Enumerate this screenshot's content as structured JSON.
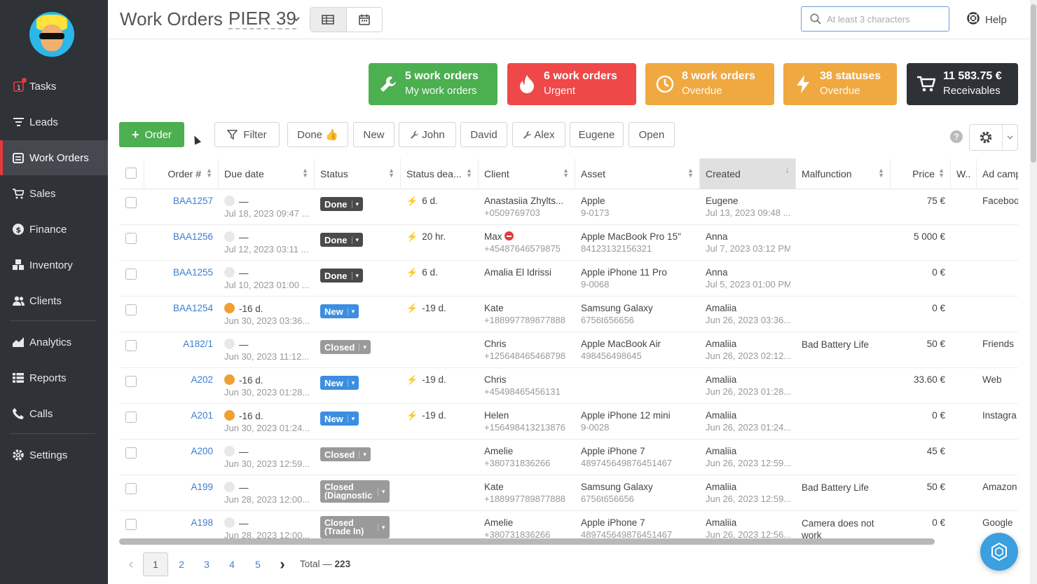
{
  "sidebar": {
    "items": [
      {
        "label": "Tasks",
        "icon": "tasks-icon"
      },
      {
        "label": "Leads",
        "icon": "filter-icon"
      },
      {
        "label": "Work Orders",
        "icon": "work-orders-icon"
      },
      {
        "label": "Sales",
        "icon": "cart-icon"
      },
      {
        "label": "Finance",
        "icon": "dollar-icon"
      },
      {
        "label": "Inventory",
        "icon": "boxes-icon"
      },
      {
        "label": "Clients",
        "icon": "users-icon"
      },
      {
        "label": "Analytics",
        "icon": "chart-icon"
      },
      {
        "label": "Reports",
        "icon": "list-icon"
      },
      {
        "label": "Calls",
        "icon": "phone-icon"
      },
      {
        "label": "Settings",
        "icon": "gear-icon"
      }
    ]
  },
  "header": {
    "title": "Work Orders",
    "location": "PIER 39",
    "search_placeholder": "At least 3 characters",
    "help_label": "Help"
  },
  "cards": [
    {
      "line1": "5 work orders",
      "line2": "My work orders",
      "color": "#4caf50",
      "icon": "wrench-icon"
    },
    {
      "line1": "6 work orders",
      "line2": "Urgent",
      "color": "#ef4848",
      "icon": "flame-icon"
    },
    {
      "line1": "8 work orders",
      "line2": "Overdue",
      "color": "#f0a840",
      "icon": "clock-icon"
    },
    {
      "line1": "38 statuses",
      "line2": "Overdue",
      "color": "#f0a840",
      "icon": "bolt-icon"
    },
    {
      "line1": "11 583.75 €",
      "line2": "Receivables",
      "color": "#2e3237",
      "icon": "cart-icon"
    }
  ],
  "filters": {
    "order_label": "Order",
    "filter_label": "Filter",
    "chips": [
      "Done 👍",
      "New",
      "John",
      "David",
      "Alex",
      "Eugene",
      "Open"
    ]
  },
  "columns": [
    "Order #",
    "Due date",
    "Status",
    "Status dea...",
    "Client",
    "Asset",
    "Created",
    "Malfunction",
    "Price",
    "W..",
    "Ad camp"
  ],
  "rows": [
    {
      "order": "BAA1257",
      "due": "—",
      "due_date": "Jul 18, 2023 09:47 ...",
      "due_clock": "grey",
      "status": "Done",
      "status_type": "done",
      "deadline": "6 d.",
      "deadline_bolt": "grey",
      "client": "Anastasiia Zhylts...",
      "phone": "+0509769703",
      "asset": "Apple",
      "asset_sub": "9-0173",
      "created_by": "Eugene",
      "created_at": "Jul 13, 2023 09:48 ...",
      "malfunction": "",
      "price": "75 €",
      "ad": "Faceboo"
    },
    {
      "order": "BAA1256",
      "due": "—",
      "due_date": "Jul 12, 2023 03:11 ...",
      "due_clock": "grey",
      "status": "Done",
      "status_type": "done",
      "deadline": "20 hr.",
      "deadline_bolt": "grey",
      "client": "Max",
      "phone": "+45487646579875",
      "asset": "Apple MacBook Pro 15\"",
      "asset_sub": "84123132156321",
      "created_by": "Anna",
      "created_at": "Jul 7, 2023 03:12 PM",
      "malfunction": "",
      "price": "5 000 €",
      "ad": ""
    },
    {
      "order": "BAA1255",
      "due": "—",
      "due_date": "Jul 10, 2023 01:00 ...",
      "due_clock": "grey",
      "status": "Done",
      "status_type": "done",
      "deadline": "6 d.",
      "deadline_bolt": "grey",
      "client": "Amalia El Idrissi",
      "phone": "",
      "asset": "Apple iPhone 11 Pro",
      "asset_sub": "9-0068",
      "created_by": "Anna",
      "created_at": "Jul 5, 2023 01:00 PM",
      "malfunction": "",
      "price": "0 €",
      "ad": ""
    },
    {
      "order": "BAA1254",
      "due": "-16 d.",
      "due_date": "Jun 30, 2023 03:36...",
      "due_clock": "orange",
      "status": "New",
      "status_type": "new",
      "deadline": "-19 d.",
      "deadline_bolt": "orange",
      "client": "Kate",
      "phone": "+188997789877888",
      "asset": "Samsung Galaxy",
      "asset_sub": "6756t656656",
      "created_by": "Amaliia",
      "created_at": "Jun 26, 2023 03:36...",
      "malfunction": "",
      "price": "0 €",
      "ad": ""
    },
    {
      "order": "A182/1",
      "due": "—",
      "due_date": "Jun 30, 2023 11:12...",
      "due_clock": "grey",
      "status": "Closed",
      "status_type": "closed",
      "deadline": "",
      "deadline_bolt": "",
      "client": "Chris",
      "phone": "+125648465468798",
      "asset": "Apple MacBook Air",
      "asset_sub": "498456498645",
      "created_by": "Amaliia",
      "created_at": "Jun 26, 2023 02:12...",
      "malfunction": "Bad Battery Life",
      "price": "50 €",
      "ad": "Friends"
    },
    {
      "order": "A202",
      "due": "-16 d.",
      "due_date": "Jun 30, 2023 01:28...",
      "due_clock": "orange",
      "status": "New",
      "status_type": "new",
      "deadline": "-19 d.",
      "deadline_bolt": "orange",
      "client": "Chris",
      "phone": "+45498465456131",
      "asset": "",
      "asset_sub": "",
      "created_by": "Amaliia",
      "created_at": "Jun 26, 2023 01:28...",
      "malfunction": "",
      "price": "33.60 €",
      "ad": "Web"
    },
    {
      "order": "A201",
      "due": "-16 d.",
      "due_date": "Jun 30, 2023 01:24...",
      "due_clock": "orange",
      "status": "New",
      "status_type": "new",
      "deadline": "-19 d.",
      "deadline_bolt": "orange",
      "client": "Helen",
      "phone": "+156498413213876",
      "asset": "Apple iPhone 12 mini",
      "asset_sub": "9-0028",
      "created_by": "Amaliia",
      "created_at": "Jun 26, 2023 01:24...",
      "malfunction": "",
      "price": "0 €",
      "ad": "Instagra"
    },
    {
      "order": "A200",
      "due": "—",
      "due_date": "Jun 30, 2023 12:59...",
      "due_clock": "grey",
      "status": "Closed",
      "status_type": "closed",
      "deadline": "",
      "deadline_bolt": "",
      "client": "Amelie",
      "phone": "+380731836266",
      "asset": "Apple iPhone 7",
      "asset_sub": "489745649876451467",
      "created_by": "Amaliia",
      "created_at": "Jun 26, 2023 12:59...",
      "malfunction": "",
      "price": "45 €",
      "ad": ""
    },
    {
      "order": "A199",
      "due": "—",
      "due_date": "Jun 28, 2023 12:00...",
      "due_clock": "grey",
      "status": "Closed (Diagnostic",
      "status_type": "closed2",
      "status_l1": "Closed",
      "status_l2": "(Diagnostic",
      "deadline": "",
      "deadline_bolt": "",
      "client": "Kate",
      "phone": "+188997789877888",
      "asset": "Samsung Galaxy",
      "asset_sub": "6756t656656",
      "created_by": "Amaliia",
      "created_at": "Jun 26, 2023 12:59...",
      "malfunction": "Bad Battery Life",
      "price": "50 €",
      "ad": "Amazon"
    },
    {
      "order": "A198",
      "due": "—",
      "due_date": "Jun 28, 2023 12:00...",
      "due_clock": "grey",
      "status": "Closed (Trade In)",
      "status_type": "closed2",
      "status_l1": "Closed",
      "status_l2": "(Trade In)",
      "deadline": "",
      "deadline_bolt": "",
      "client": "Amelie",
      "phone": "+380731836266",
      "asset": "Apple iPhone 7",
      "asset_sub": "489745649876451467",
      "created_by": "Amaliia",
      "created_at": "Jun 26, 2023 12:56...",
      "malfunction": "Camera does not work",
      "price": "0 €",
      "ad": "Google"
    }
  ],
  "pagination": {
    "pages": [
      "1",
      "2",
      "3",
      "4",
      "5"
    ],
    "current": "1",
    "total_label": "Total —",
    "total": "223"
  }
}
